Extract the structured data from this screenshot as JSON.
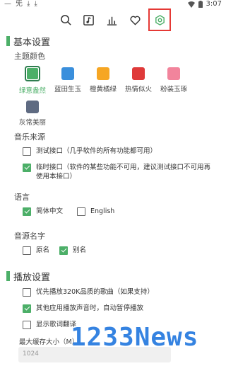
{
  "status_bar": {
    "time": "3:07",
    "left_icons": [
      "signal-glyph",
      "download-glyph",
      "download-glyph"
    ],
    "right_icons": [
      "wifi-icon",
      "battery-icon"
    ]
  },
  "toolbar": {
    "buttons": [
      {
        "icon": "search-icon",
        "active": false
      },
      {
        "icon": "music-sheet-icon",
        "active": false
      },
      {
        "icon": "chart-bars-icon",
        "active": false
      },
      {
        "icon": "heart-icon",
        "active": false
      },
      {
        "icon": "settings-icon",
        "active": true
      }
    ],
    "accent_color": "#4caf68",
    "highlight_color": "#e53935"
  },
  "basic": {
    "title": "基本设置",
    "theme": {
      "label": "主题颜色",
      "swatches": [
        {
          "name": "绿意盎然",
          "color": "#4caf68",
          "selected": true
        },
        {
          "name": "蓝田生玉",
          "color": "#3a8fdc",
          "selected": false
        },
        {
          "name": "橙黄橘绿",
          "color": "#f6a623",
          "selected": false
        },
        {
          "name": "热情似火",
          "color": "#df3a3a",
          "selected": false
        },
        {
          "name": "粉装玉琢",
          "color": "#f2849c",
          "selected": false
        },
        {
          "name": "灰常美丽",
          "color": "#5f6b82",
          "selected": false
        }
      ]
    },
    "source": {
      "label": "音乐来源",
      "options": [
        {
          "text": "测试接口（几乎软件的所有功能都可用）",
          "checked": false
        },
        {
          "text_line1": "临时接口（软件的某些功能不可用，建议测试接口不可用再",
          "text_line2": "使用本接口）",
          "checked": true
        }
      ]
    },
    "language": {
      "label": "语言",
      "options": [
        {
          "text": "简体中文",
          "checked": true
        },
        {
          "text": "English",
          "checked": false
        }
      ]
    },
    "source_name": {
      "label": "音源名字",
      "options": [
        {
          "text": "原名",
          "checked": false
        },
        {
          "text": "别名",
          "checked": true
        }
      ]
    }
  },
  "playback": {
    "title": "播放设置",
    "options": [
      {
        "text": "优先播放320K品质的歌曲（如果支持）",
        "checked": false
      },
      {
        "text": "其他应用播放声音时，自动暂停播放",
        "checked": true
      },
      {
        "text": "显示歌词翻译",
        "checked": false
      }
    ],
    "cache": {
      "label": "最大缓存大小（M）",
      "value": "1024"
    }
  },
  "watermark": "1233News"
}
